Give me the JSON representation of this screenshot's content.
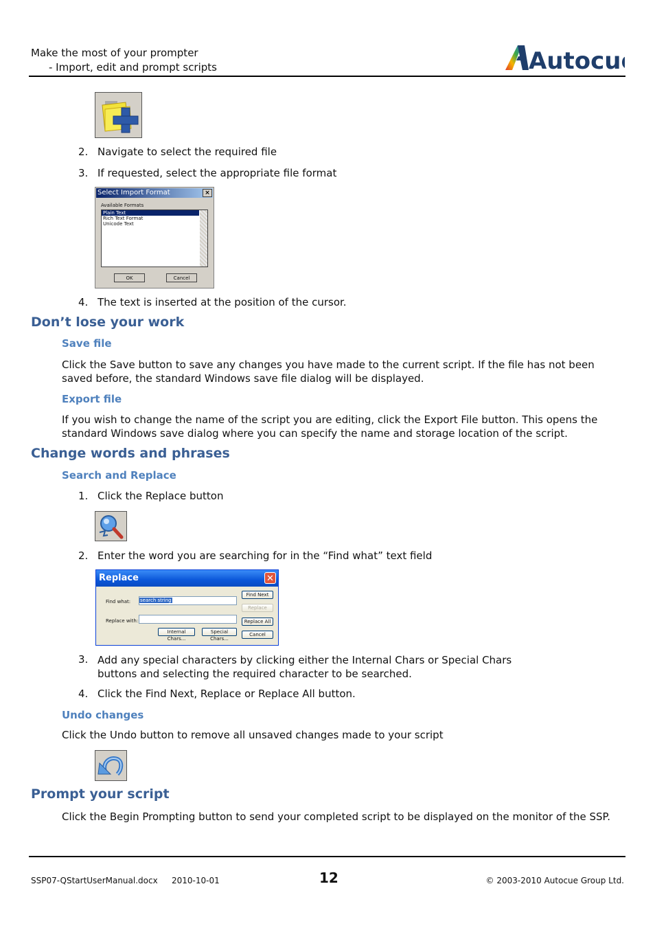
{
  "header": {
    "title_line1": "Make the most of your prompter",
    "title_line2": "- Import, edit and prompt scripts",
    "logo_text": "Autocue"
  },
  "import_section": {
    "icon": "import-file-icon",
    "steps": [
      {
        "num": "2.",
        "text": "Navigate to select the required file"
      },
      {
        "num": "3.",
        "text": "If requested, select the appropriate file format"
      },
      {
        "num": "4.",
        "text": "The text is inserted at the position of the cursor."
      }
    ],
    "import_dialog": {
      "title": "Select Import Format",
      "close": "×",
      "label": "Available Formats",
      "formats": [
        "Plain Text",
        "Rich Text Format",
        "Unicode Text"
      ],
      "selected": "Plain Text",
      "ok": "OK",
      "cancel": "Cancel"
    }
  },
  "dont_lose": {
    "heading": "Don’t lose your work",
    "save": {
      "heading": "Save file",
      "text": "Click the Save button to save any changes you have made to the current script. If the file has not been saved before, the standard Windows save file dialog will be displayed."
    },
    "export": {
      "heading": "Export file",
      "text": "If you wish to change the name of the script you are editing, click the Export File button. This opens the standard Windows save dialog where you can specify the name and storage location of the script."
    }
  },
  "change_words": {
    "heading": "Change words and phrases",
    "search_heading": "Search and Replace",
    "steps": [
      {
        "num": "1.",
        "text": "Click the Replace button"
      },
      {
        "num": "2.",
        "text": "Enter the word you are searching for in the “Find what” text field"
      },
      {
        "num": "3.",
        "text": "Add any special characters by clicking either the Internal Chars or Special Chars buttons and selecting the required character to be searched."
      },
      {
        "num": "4.",
        "text": "Click the Find Next, Replace or Replace All button."
      }
    ],
    "replace_dialog": {
      "title": "Replace",
      "close": "✕",
      "find_label": "Find what:",
      "find_value": "search string",
      "replace_label": "Replace with:",
      "replace_value": "",
      "internal_chars": "Internal Chars...",
      "special_chars": "Special Chars...",
      "find_next": "Find Next",
      "replace": "Replace",
      "replace_all": "Replace All",
      "cancel": "Cancel"
    },
    "undo": {
      "heading": "Undo changes",
      "text": "Click the Undo button to remove all unsaved changes made to your script"
    }
  },
  "prompt": {
    "heading": "Prompt your script",
    "text": "Click the Begin Prompting button to send your completed script to be displayed on the monitor of the SSP."
  },
  "footer": {
    "filename": "SSP07-QStartUserManual.docx",
    "date": "2010-10-01",
    "page": "12",
    "copyright": "© 2003-2010 Autocue Group Ltd."
  },
  "colors": {
    "heading1": "#3a5f94",
    "heading2": "#4f81bd",
    "logo": "#1f3e6b"
  }
}
